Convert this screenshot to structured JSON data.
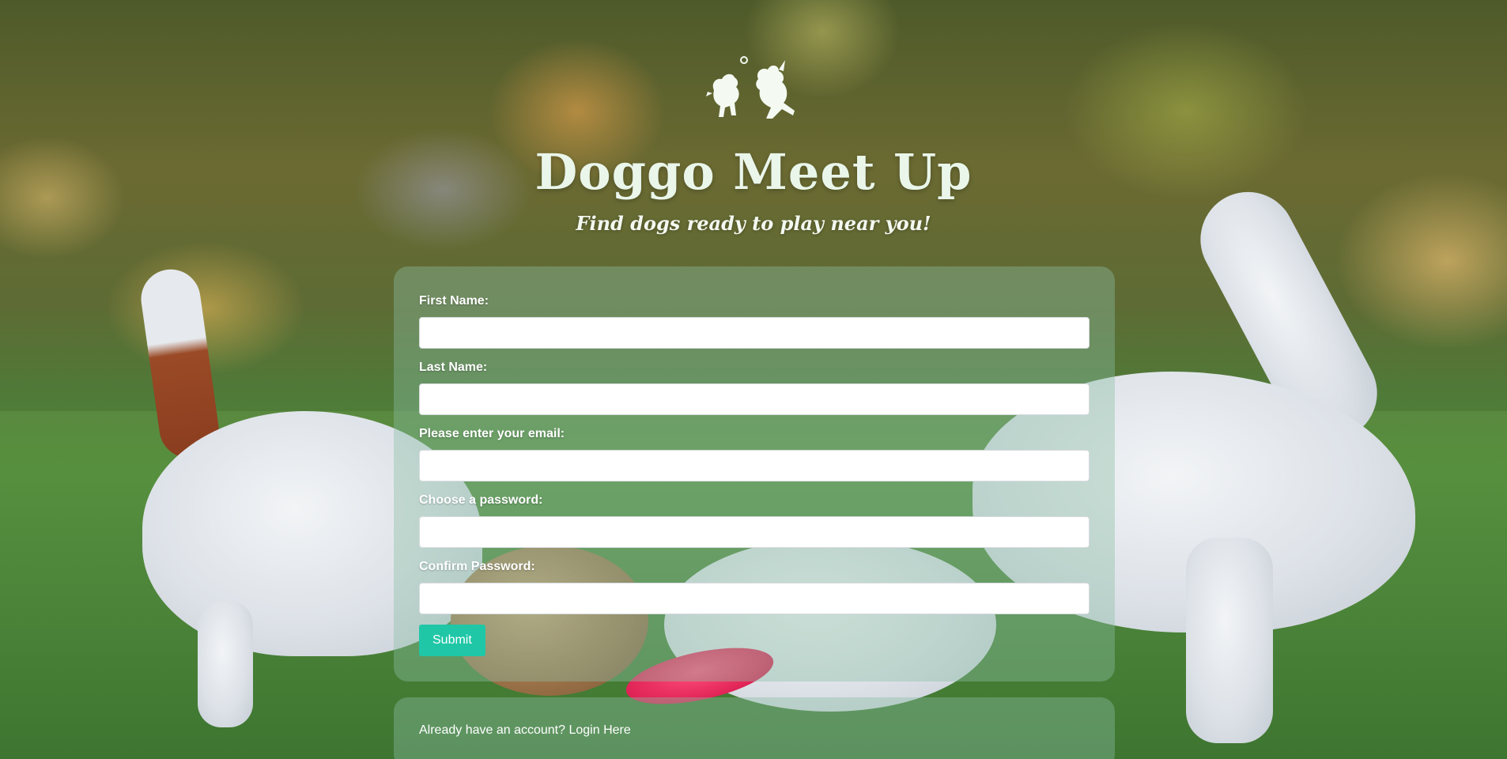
{
  "header": {
    "logo_icon": "playing-dogs-icon",
    "title": "Doggo Meet Up",
    "subtitle": "Find dogs ready to play near you!"
  },
  "form": {
    "fields": [
      {
        "label": "First Name:",
        "value": "",
        "type": "text"
      },
      {
        "label": "Last Name:",
        "value": "",
        "type": "text"
      },
      {
        "label": "Please enter your email:",
        "value": "",
        "type": "email"
      },
      {
        "label": "Choose a password:",
        "value": "",
        "type": "password"
      },
      {
        "label": "Confirm Password:",
        "value": "",
        "type": "password"
      }
    ],
    "submit_label": "Submit"
  },
  "login": {
    "prompt": "Already have an account?",
    "link_label": "Login Here"
  },
  "colors": {
    "accent": "#1fc7a7",
    "card": "rgba(140,190,165,0.40)",
    "title": "#eaf6ea"
  }
}
